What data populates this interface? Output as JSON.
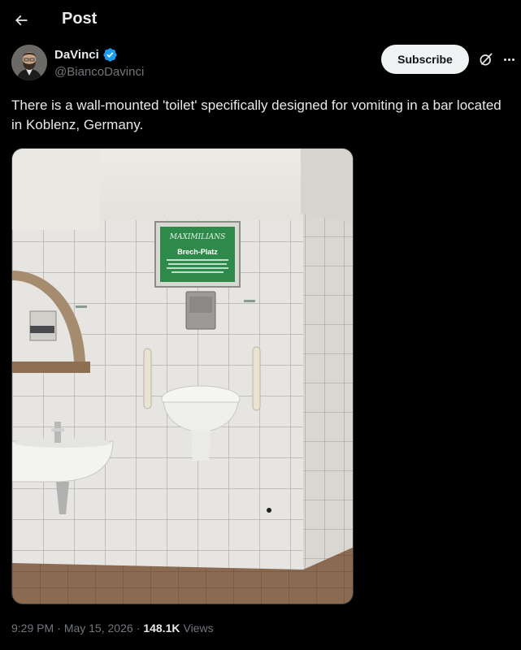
{
  "header": {
    "title": "Post"
  },
  "author": {
    "display_name": "DaVinci",
    "handle": "@BiancoDavinci",
    "verified": true
  },
  "actions": {
    "subscribe_label": "Subscribe"
  },
  "post": {
    "text": "There is a wall-mounted 'toilet' specifically designed for vomiting in a bar located in Koblenz, Germany.",
    "sign": {
      "brand": "MAXIMILIANS",
      "title": "Brech-Platz"
    }
  },
  "meta": {
    "time": "9:29 PM",
    "separator": "·",
    "date": "May 15, 2026",
    "separator2": "·",
    "views_count": "148.1K",
    "views_label": "Views"
  },
  "colors": {
    "background": "#000000",
    "text": "#e7e9ea",
    "muted": "#71767b",
    "verified": "#1d9bf0",
    "sign_green": "#2e8a4a"
  }
}
